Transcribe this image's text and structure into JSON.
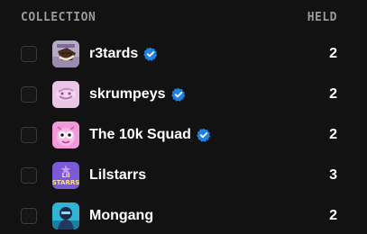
{
  "header": {
    "collection_label": "COLLECTION",
    "held_label": "HELD"
  },
  "collections": [
    {
      "name": "r3tards",
      "verified": true,
      "held": "2",
      "thumb_icon": "r3tards-thumbnail",
      "thumb_logo_text": "r3tards"
    },
    {
      "name": "skrumpeys",
      "verified": true,
      "held": "2",
      "thumb_icon": "skrumpeys-thumbnail"
    },
    {
      "name": "The 10k Squad",
      "verified": true,
      "held": "2",
      "thumb_icon": "10k-squad-thumbnail"
    },
    {
      "name": "Lilstarrs",
      "verified": false,
      "held": "3",
      "thumb_icon": "lilstarrs-thumbnail",
      "thumb_logo_text": "Lil STARRS"
    },
    {
      "name": "Mongang",
      "verified": false,
      "held": "2",
      "thumb_icon": "mongang-thumbnail"
    }
  ],
  "colors": {
    "background": "#121212",
    "header_text": "#9a9a9a",
    "verified_badge": "#2081e2",
    "checkbox_border": "#3a3a3a"
  }
}
